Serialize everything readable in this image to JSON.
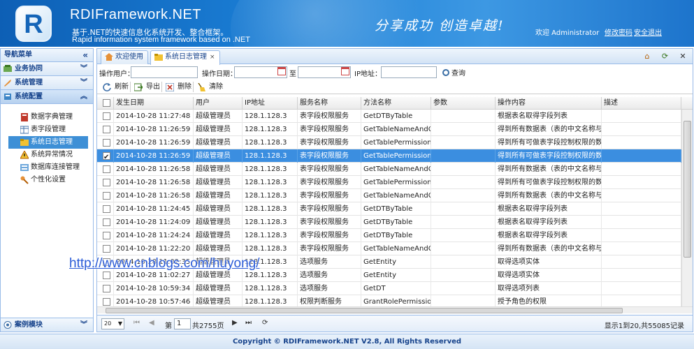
{
  "header": {
    "logo_letter": "R",
    "brand": "RDIFramework.NET",
    "subtitle_cn": "基于.NET的快速信息化系统开发、整合框架。",
    "subtitle_en": "Rapid information system framework based on .NET",
    "slogan": "分享成功  创造卓越!",
    "welcome": "欢迎 Administrator",
    "change_password": "修改密码",
    "logout": "安全退出"
  },
  "nav": {
    "title": "导航菜单",
    "collapse": "«",
    "sections": [
      {
        "label": "业务协同",
        "icon": "cooperation-icon"
      },
      {
        "label": "系统管理",
        "icon": "wrench-icon"
      },
      {
        "label": "系统配置",
        "icon": "config-icon"
      }
    ],
    "tree": [
      {
        "label": "数据字典管理",
        "icon": "dictionary-icon"
      },
      {
        "label": "表字段管理",
        "icon": "table-icon"
      },
      {
        "label": "系统日志管理",
        "icon": "log-icon"
      },
      {
        "label": "系统异常情况",
        "icon": "warning-icon"
      },
      {
        "label": "数据库连接管理",
        "icon": "database-icon"
      },
      {
        "label": "个性化设置",
        "icon": "key-icon"
      }
    ],
    "bottom_section": {
      "label": "案例模块",
      "icon": "case-icon"
    }
  },
  "tabs": [
    {
      "label": "欢迎使用",
      "icon": "home-icon"
    },
    {
      "label": "系统日志管理",
      "icon": "log-icon",
      "close": "×"
    }
  ],
  "tab_tools": {
    "home": "⌂",
    "refresh": "⟳",
    "close": "✕"
  },
  "search": {
    "operator_label": "操作用户：",
    "operator_value": "",
    "date_label": "操作日期：",
    "date_from": "",
    "to_label": "至",
    "date_to": "",
    "ip_label": "IP地址：",
    "ip_value": "",
    "query_label": "查询"
  },
  "toolbar": {
    "refresh": "刷新",
    "export": "导出",
    "delete": "删除",
    "clear": "清除"
  },
  "grid": {
    "columns": [
      "发生日期",
      "用户",
      "IP地址",
      "服务名称",
      "方法名称",
      "参数",
      "操作内容",
      "描述"
    ],
    "rows": [
      {
        "checked": false,
        "cells": [
          "2014-10-28 11:27:48",
          "超级管理员",
          "128.1.128.3",
          "表字段权限服务",
          "GetDTByTable",
          "",
          "根据表名取得字段列表",
          ""
        ]
      },
      {
        "checked": false,
        "cells": [
          "2014-10-28 11:26:59",
          "超级管理员",
          "128.1.128.3",
          "表字段权限服务",
          "GetTableNameAndC",
          "",
          "得到所有数据表（表的中文名称与英文",
          ""
        ]
      },
      {
        "checked": false,
        "cells": [
          "2014-10-28 11:26:59",
          "超级管理员",
          "128.1.128.3",
          "表字段权限服务",
          "GetTablePermission",
          "",
          "得到所有可做表字段控制权限的数据",
          ""
        ]
      },
      {
        "checked": true,
        "cells": [
          "2014-10-28 11:26:59",
          "超级管理员",
          "128.1.128.3",
          "表字段权限服务",
          "GetTablePermission",
          "",
          "得到所有可做表字段控制权限的数据",
          ""
        ]
      },
      {
        "checked": false,
        "cells": [
          "2014-10-28 11:26:58",
          "超级管理员",
          "128.1.128.3",
          "表字段权限服务",
          "GetTableNameAndC",
          "",
          "得到所有数据表（表的中文名称与英文",
          ""
        ]
      },
      {
        "checked": false,
        "cells": [
          "2014-10-28 11:26:58",
          "超级管理员",
          "128.1.128.3",
          "表字段权限服务",
          "GetTablePermission",
          "",
          "得到所有可做表字段控制权限的数据",
          ""
        ]
      },
      {
        "checked": false,
        "cells": [
          "2014-10-28 11:26:58",
          "超级管理员",
          "128.1.128.3",
          "表字段权限服务",
          "GetTableNameAndC",
          "",
          "得到所有数据表（表的中文名称与英文",
          ""
        ]
      },
      {
        "checked": false,
        "cells": [
          "2014-10-28 11:24:45",
          "超级管理员",
          "128.1.128.3",
          "表字段权限服务",
          "GetDTByTable",
          "",
          "根据表名取得字段列表",
          ""
        ]
      },
      {
        "checked": false,
        "cells": [
          "2014-10-28 11:24:09",
          "超级管理员",
          "128.1.128.3",
          "表字段权限服务",
          "GetDTByTable",
          "",
          "根据表名取得字段列表",
          ""
        ]
      },
      {
        "checked": false,
        "cells": [
          "2014-10-28 11:24:24",
          "超级管理员",
          "128.1.128.3",
          "表字段权限服务",
          "GetDTByTable",
          "",
          "根据表名取得字段列表",
          ""
        ]
      },
      {
        "checked": false,
        "cells": [
          "2014-10-28 11:22:20",
          "超级管理员",
          "128.1.128.3",
          "表字段权限服务",
          "GetTableNameAndC",
          "",
          "得到所有数据表（表的中文名称与英文",
          ""
        ]
      },
      {
        "checked": false,
        "cells": [
          "2014-10-28 11:02:35",
          "超级管理员",
          "128.1.128.3",
          "选项服务",
          "GetEntity",
          "",
          "取得选项实体",
          ""
        ]
      },
      {
        "checked": false,
        "cells": [
          "2014-10-28 11:02:27",
          "超级管理员",
          "128.1.128.3",
          "选项服务",
          "GetEntity",
          "",
          "取得选项实体",
          ""
        ]
      },
      {
        "checked": false,
        "cells": [
          "2014-10-28 10:59:34",
          "超级管理员",
          "128.1.128.3",
          "选项服务",
          "GetDT",
          "",
          "取得选项列表",
          ""
        ]
      },
      {
        "checked": false,
        "cells": [
          "2014-10-28 10:57:46",
          "超级管理员",
          "128.1.128.3",
          "权限判断服务",
          "GrantRolePermission",
          "",
          "授予角色的权限",
          ""
        ]
      }
    ]
  },
  "watermark": "http://www.cnblogs.com/huyong/",
  "pager": {
    "page_size": "20",
    "page_prefix": "第",
    "page_number": "1",
    "page_suffix": "共2755页",
    "info": "显示1到20,共55085记录"
  },
  "footer": "Copyright © RDIFramework.NET V2.8, All Rights Reserved",
  "colors": {
    "header_blue": "#1b7fd6",
    "selection_blue": "#3b8ee0",
    "panel_border": "#99bbe8",
    "nav_text": "#15428b"
  }
}
